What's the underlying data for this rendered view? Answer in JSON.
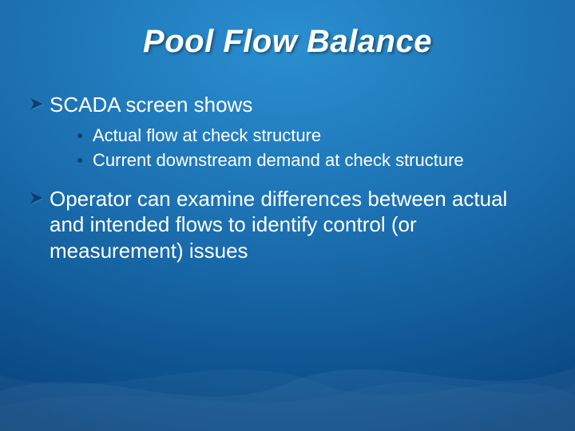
{
  "title": "Pool Flow Balance",
  "bullets": {
    "b1": "SCADA screen shows",
    "b1_sub1": "Actual flow at check structure",
    "b1_sub2": "Current downstream demand at check structure",
    "b2": "Operator can examine differences between actual and intended flows to identify control (or measurement) issues"
  }
}
